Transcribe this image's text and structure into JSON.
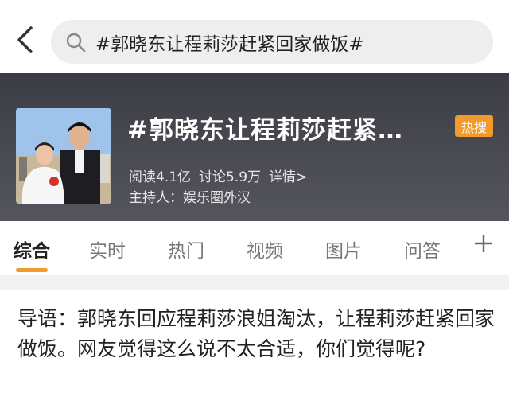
{
  "search": {
    "query": "#郭晓东让程莉莎赶紧回家做饭#"
  },
  "topic": {
    "title": "#郭晓东让程莉莎赶紧…",
    "badge": "热搜",
    "reads": "阅读4.1亿",
    "discussions": "讨论5.9万",
    "details": "详情>",
    "host": "主持人：娱乐圈外汉"
  },
  "tabs": [
    {
      "label": "综合",
      "active": true
    },
    {
      "label": "实时",
      "active": false
    },
    {
      "label": "热门",
      "active": false
    },
    {
      "label": "视频",
      "active": false
    },
    {
      "label": "图片",
      "active": false
    },
    {
      "label": "问答",
      "active": false
    }
  ],
  "lead": "导语：郭晓东回应程莉莎浪姐淘汰，让程莉莎赶紧回家做饭。网友觉得这么说不太合适，你们觉得呢?",
  "colors": {
    "accent": "#f39a2c",
    "banner": "#45454d"
  },
  "icons": {
    "back": "chevron-left-icon",
    "search": "search-icon",
    "more": "plus-icon"
  }
}
